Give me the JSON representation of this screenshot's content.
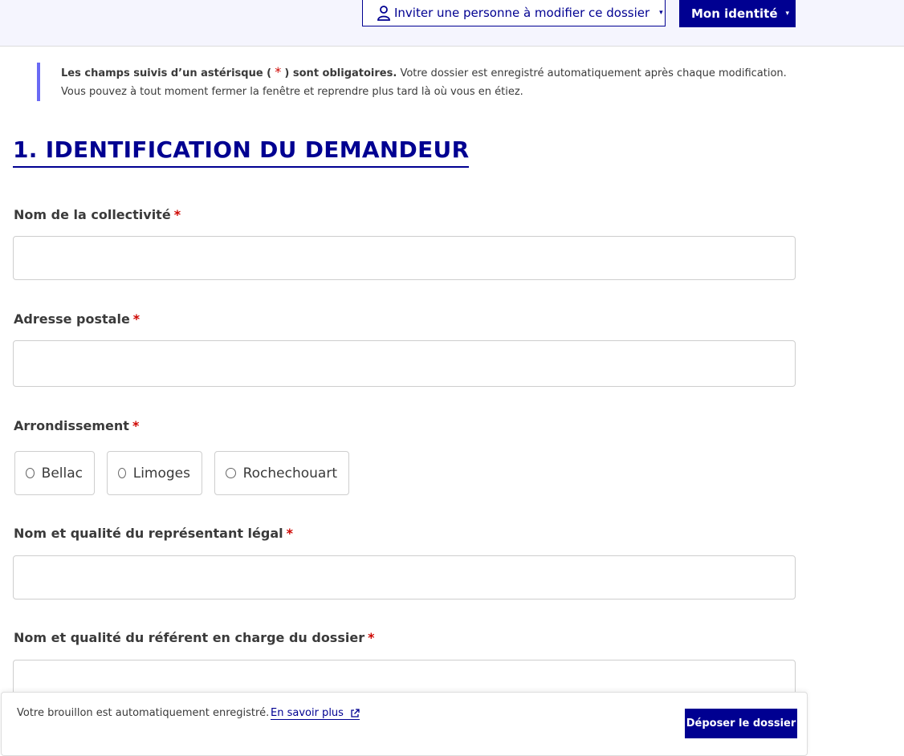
{
  "header": {
    "invite_button": "Inviter une personne à modifier ce dossier",
    "identity_button": "Mon identité",
    "caret": "▾"
  },
  "notice": {
    "bold_text": "Les champs suivis d’un astérisque (",
    "asterisk": "*",
    "bold_text_end": ") sont obligatoires.",
    "text": "Votre dossier est enregistré automatiquement après chaque modification. Vous pouvez à tout moment fermer la fenêtre et reprendre plus tard là où vous en étiez."
  },
  "section": {
    "title": "1. IDENTIFICATION DU DEMANDEUR"
  },
  "fields": {
    "collectivite": {
      "label": "Nom de la collectivité",
      "value": ""
    },
    "adresse": {
      "label": "Adresse postale",
      "value": ""
    },
    "arrondissement": {
      "label": "Arrondissement",
      "options": [
        "Bellac",
        "Limoges",
        "Rochechouart"
      ]
    },
    "representant": {
      "label": "Nom et qualité du représentant légal",
      "value": ""
    },
    "referent": {
      "label": "Nom et qualité du référent en charge du dossier",
      "value": ""
    },
    "required_mark": "*"
  },
  "footer": {
    "draft_text": "Votre brouillon est automatiquement enregistré.",
    "learn_more": "En savoir plus",
    "submit_button": "Déposer le dossier"
  },
  "colors": {
    "primary": "#000091",
    "required": "#ce0500",
    "notice_border": "#6a6af4",
    "header_bg": "#f5f5fe"
  }
}
